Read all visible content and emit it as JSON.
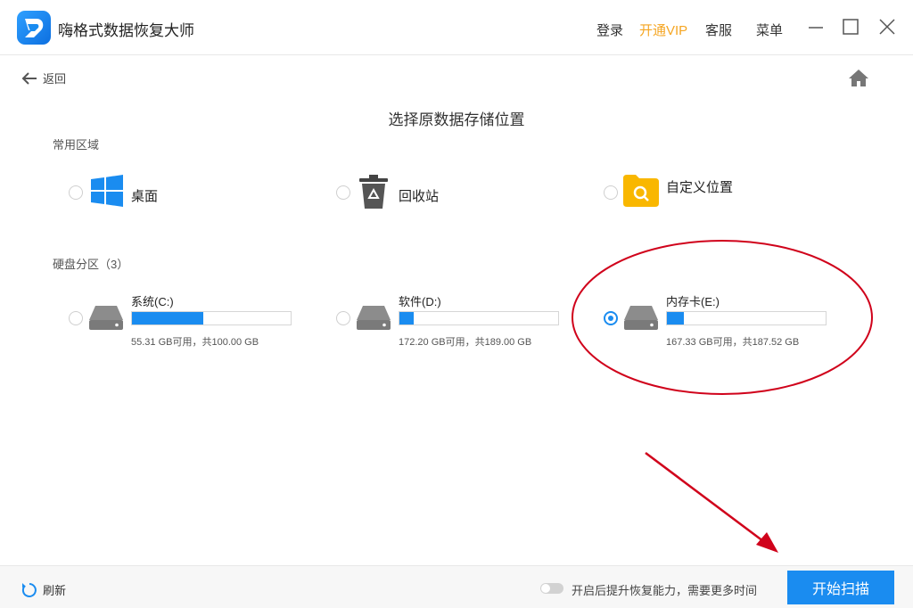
{
  "app": {
    "title": "嗨格式数据恢复大师"
  },
  "header": {
    "login": "登录",
    "vip": "开通VIP",
    "service": "客服",
    "menu": "菜单"
  },
  "nav": {
    "back": "返回"
  },
  "page": {
    "title": "选择原数据存储位置"
  },
  "common": {
    "label": "常用区域",
    "items": [
      {
        "label": "桌面",
        "icon": "windows-icon",
        "selected": false
      },
      {
        "label": "回收站",
        "icon": "recycle-bin-icon",
        "selected": false
      },
      {
        "label": "自定义位置",
        "icon": "folder-search-icon",
        "selected": false
      }
    ]
  },
  "drives": {
    "label": "硬盘分区（3）",
    "items": [
      {
        "name": "系统(C:)",
        "size_text": "55.31 GB可用，共100.00 GB",
        "used_fraction": 0.447,
        "selected": false
      },
      {
        "name": "软件(D:)",
        "size_text": "172.20 GB可用，共189.00 GB",
        "used_fraction": 0.089,
        "selected": false
      },
      {
        "name": "内存卡(E:)",
        "size_text": "167.33 GB可用，共187.52 GB",
        "used_fraction": 0.108,
        "selected": true
      }
    ]
  },
  "footer": {
    "refresh": "刷新",
    "toggle_label": "开启后提升恢复能力，需要更多时间",
    "toggle_on": false,
    "start": "开始扫描"
  },
  "colors": {
    "accent": "#1a8cf0",
    "vip": "#f5a623",
    "annotation": "#d0021b"
  }
}
